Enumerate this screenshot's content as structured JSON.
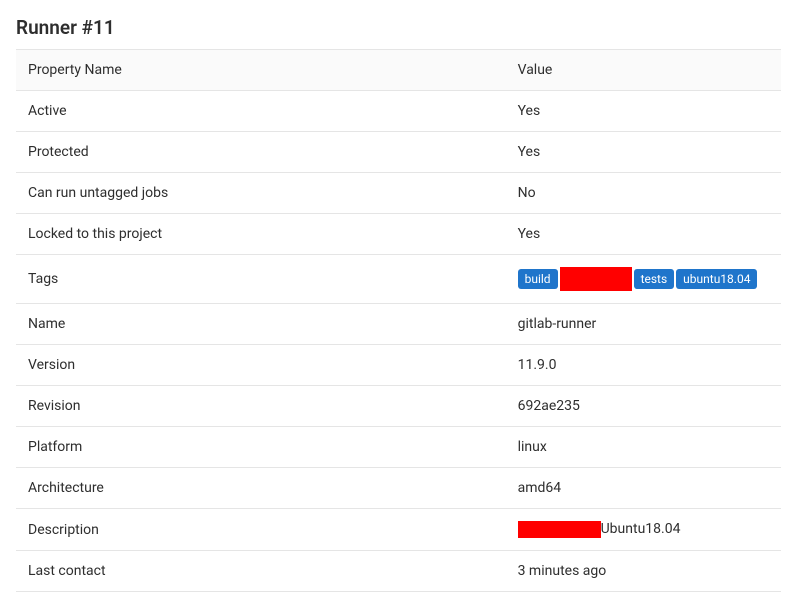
{
  "title": "Runner #11",
  "header": {
    "property": "Property Name",
    "value": "Value"
  },
  "rows": {
    "active": {
      "label": "Active",
      "value": "Yes"
    },
    "protected": {
      "label": "Protected",
      "value": "Yes"
    },
    "untagged": {
      "label": "Can run untagged jobs",
      "value": "No"
    },
    "locked": {
      "label": "Locked to this project",
      "value": "Yes"
    },
    "tags": {
      "label": "Tags"
    },
    "name": {
      "label": "Name",
      "value": "gitlab-runner"
    },
    "version": {
      "label": "Version",
      "value": "11.9.0"
    },
    "revision": {
      "label": "Revision",
      "value": "692ae235"
    },
    "platform": {
      "label": "Platform",
      "value": "linux"
    },
    "arch": {
      "label": "Architecture",
      "value": "amd64"
    },
    "description": {
      "label": "Description",
      "suffix": "Ubuntu18.04"
    },
    "last_contact": {
      "label": "Last contact",
      "value": "3 minutes ago"
    }
  },
  "tags": {
    "t0": "build",
    "t1": "tests",
    "t2": "ubuntu18.04"
  }
}
